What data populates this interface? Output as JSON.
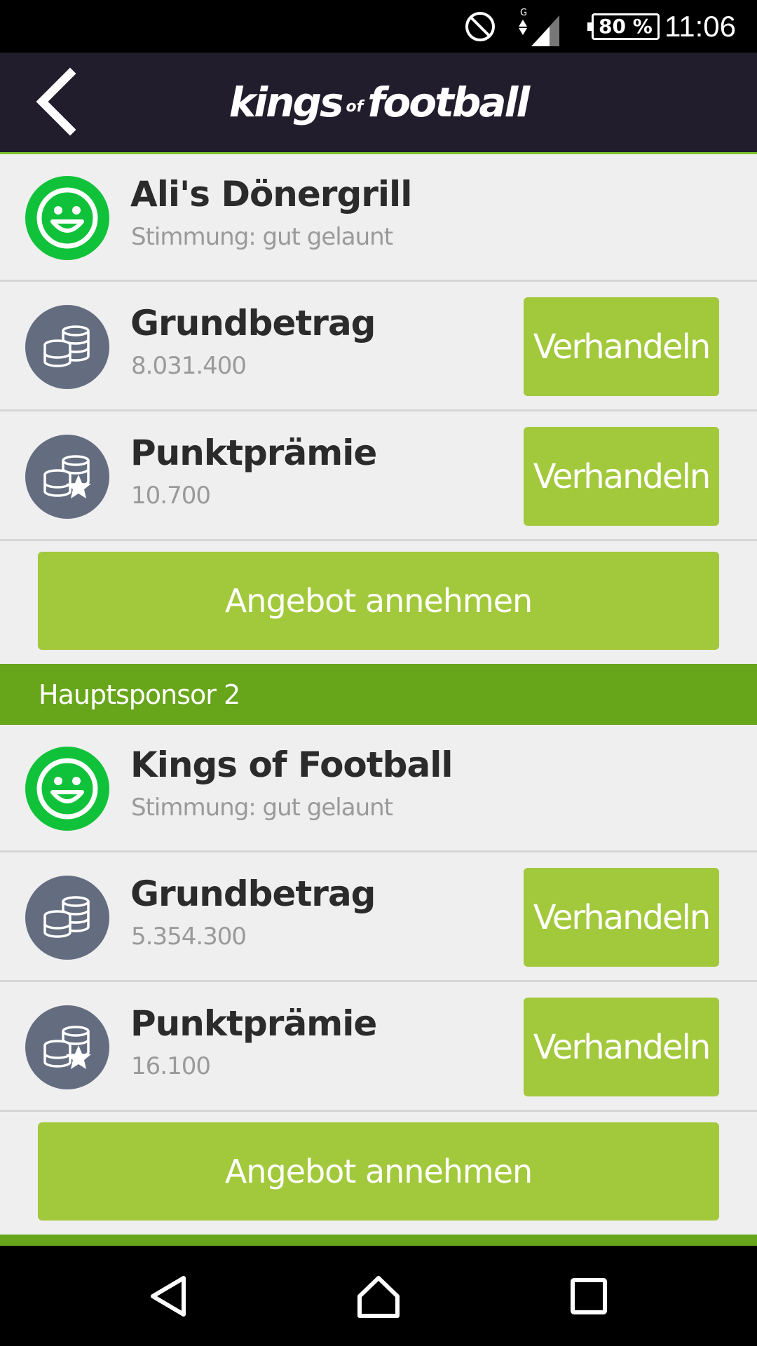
{
  "status_bar": {
    "network_label": "G",
    "battery": "80 %",
    "time": "11:06",
    "icons": [
      "dnd-icon",
      "signal-icon",
      "battery-icon"
    ]
  },
  "header": {
    "brand_part1": "kings",
    "brand_part2": "of",
    "brand_part3": "football",
    "back_icon": "chevron-left-icon"
  },
  "sponsors": [
    {
      "name": "Ali's Dönergrill",
      "mood": "Stimmung: gut gelaunt",
      "base_label": "Grundbetrag",
      "base_value": "8.031.400",
      "bonus_label": "Punktprämie",
      "bonus_value": "10.700",
      "negotiate_label": "Verhandeln",
      "accept_label": "Angebot annehmen"
    },
    {
      "section_title": "Hauptsponsor 2",
      "name": "Kings of Football",
      "mood": "Stimmung: gut gelaunt",
      "base_label": "Grundbetrag",
      "base_value": "5.354.300",
      "bonus_label": "Punktprämie",
      "bonus_value": "16.100",
      "negotiate_label": "Verhandeln",
      "accept_label": "Angebot annehmen"
    }
  ],
  "colors": {
    "header_bg": "#221d2c",
    "accent_green": "#a2c83b",
    "section_green": "#67a51b",
    "mood_green": "#10c23a",
    "coin_slate": "#646d80",
    "background": "#efefef"
  },
  "nav_bar": {
    "icons": [
      "nav-back-icon",
      "nav-home-icon",
      "nav-recent-icon"
    ]
  }
}
